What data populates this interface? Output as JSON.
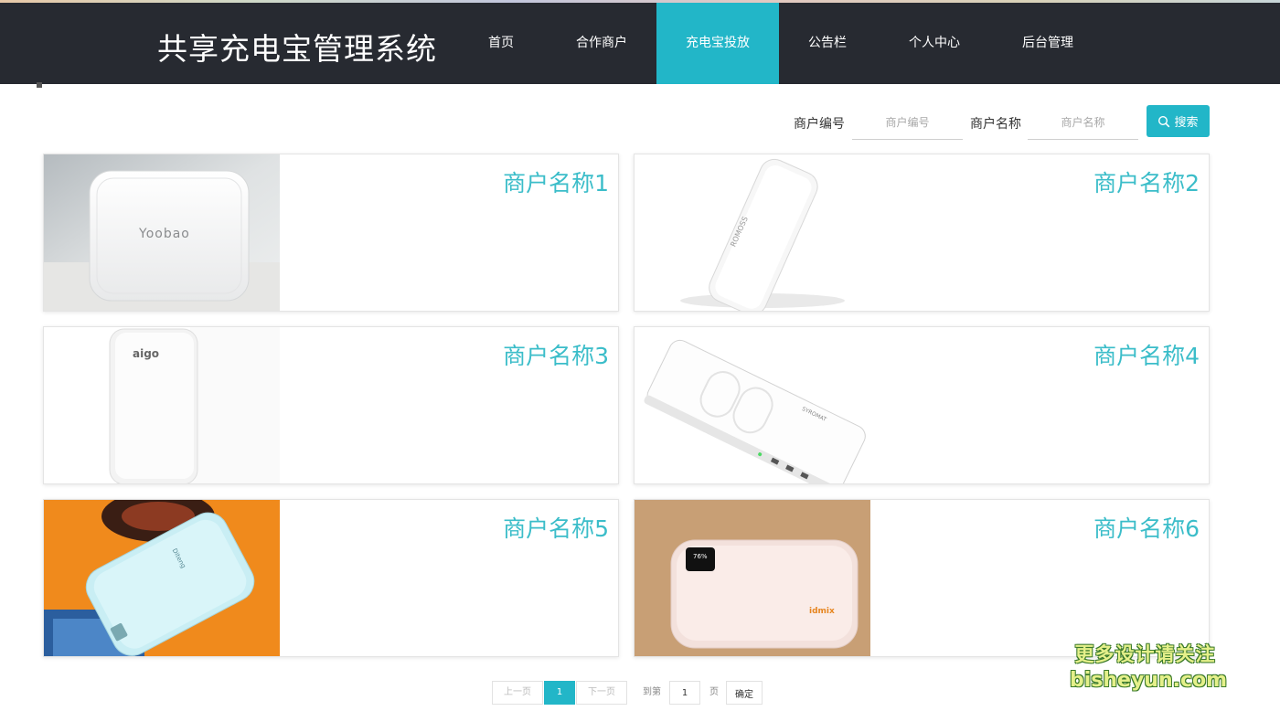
{
  "brand": {
    "title": "共享充电宝管理系统"
  },
  "nav": {
    "items": [
      {
        "label": "首页"
      },
      {
        "label": "合作商户"
      },
      {
        "label": "充电宝投放"
      },
      {
        "label": "公告栏"
      },
      {
        "label": "个人中心"
      },
      {
        "label": "后台管理"
      }
    ],
    "active_index": 2,
    "accent_color": "#22b6c8"
  },
  "search": {
    "merchant_no_label": "商户编号",
    "merchant_no_placeholder": "商户编号",
    "merchant_name_label": "商户名称",
    "merchant_name_placeholder": "商户名称",
    "button_label": "搜索",
    "button_icon": "search-icon"
  },
  "cards": [
    {
      "title": "商户名称1",
      "image_brand": "Yoobao"
    },
    {
      "title": "商户名称2",
      "image_brand": "ROMOSS"
    },
    {
      "title": "商户名称3",
      "image_brand": "aigo"
    },
    {
      "title": "商户名称4",
      "image_brand": "SYROMAT"
    },
    {
      "title": "商户名称5",
      "image_brand": "Diteng"
    },
    {
      "title": "商户名称6",
      "image_brand": "idmix",
      "image_screen": "76%"
    }
  ],
  "pagination": {
    "prev_label": "上一页",
    "current_page": "1",
    "next_label": "下一页",
    "goto_prefix": "到第",
    "goto_value": "1",
    "goto_suffix": "页",
    "confirm_label": "确定"
  },
  "watermark": {
    "line1": "更多设计请关注",
    "line2": "bisheyun.com"
  }
}
